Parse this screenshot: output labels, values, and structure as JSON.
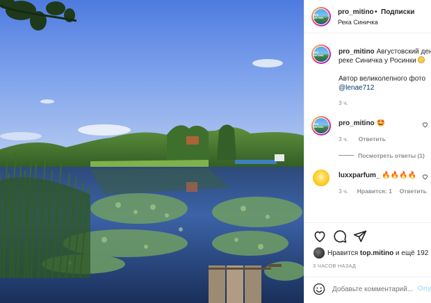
{
  "post": {
    "username": "pro_mitino",
    "follow_label": "Подписки",
    "bullet": "•",
    "location": "Река Синичка",
    "avatar_text": "ПРО МИТИНО"
  },
  "caption": {
    "username": "pro_mitino",
    "line1": "Августовский ден",
    "line2": "реке Синичка у Росинки",
    "line3": "Автор великолепного фото",
    "mention": "@lenae712",
    "time": "3 ч."
  },
  "comments": [
    {
      "username": "pro_mitino",
      "text": "🤩",
      "time": "3 ч.",
      "reply_label": "Ответить",
      "view_replies": "Посмотреть ответы (1)"
    },
    {
      "username": "luxxparfum_",
      "text": "🔥🔥🔥🔥",
      "time": "3 ч.",
      "likes": "Нравится: 1",
      "reply_label": "Ответить"
    }
  ],
  "likes": {
    "prefix": "Нравится",
    "user": "top.mitino",
    "suffix": "и ещё 192"
  },
  "timestamp": "3 ЧАСОВ НАЗАД",
  "comment_input": {
    "placeholder": "Добавьте комментарий...",
    "post_label": "Опу"
  },
  "icons": {
    "like": "heart-icon",
    "comment": "comment-icon",
    "share": "paper-plane-icon",
    "emoji": "smiley-icon"
  },
  "colors": {
    "link": "#00376b",
    "muted": "#8e8e8e",
    "post_button": "#b2dffc",
    "text": "#262626"
  }
}
